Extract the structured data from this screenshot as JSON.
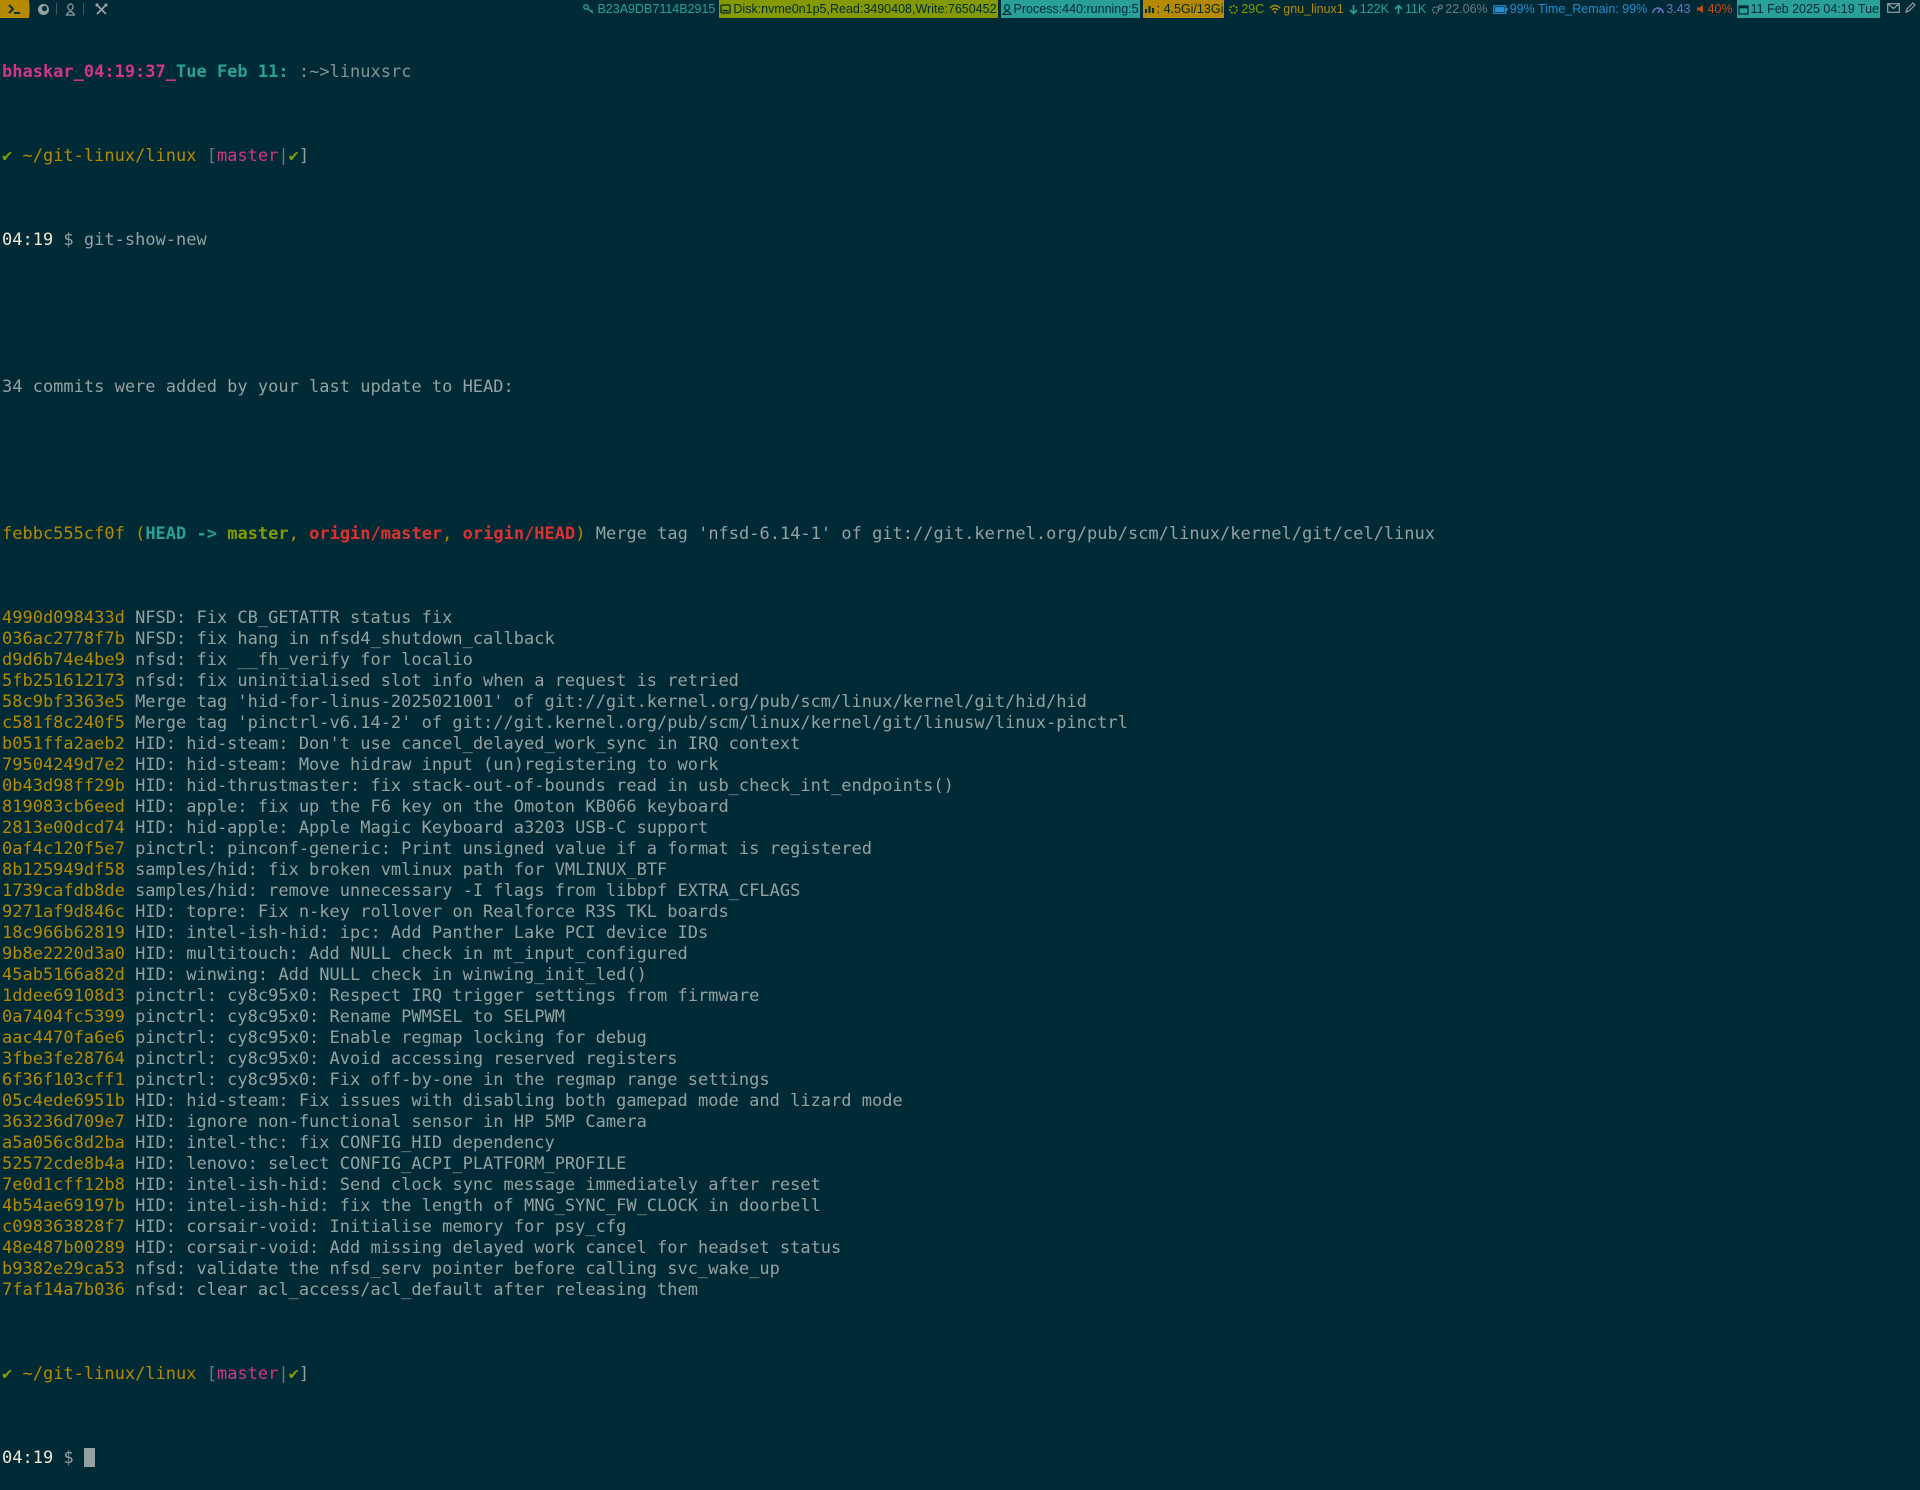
{
  "colors": {
    "background": "#002b36",
    "foreground": "#93a1a1",
    "yellow": "#b58900",
    "magenta": "#d33682",
    "cyan": "#2aa198",
    "green": "#859900",
    "red": "#dc322f",
    "blue": "#268bd2",
    "violet": "#6c71c4",
    "orange": "#cb4b16"
  },
  "statusbar": {
    "workspaces": [
      {
        "icon": "terminal-icon",
        "active": true
      },
      {
        "icon": "firefox-icon",
        "active": false
      },
      {
        "icon": "linux-tux-icon",
        "active": false
      },
      {
        "icon": "tools-icon",
        "active": false
      }
    ],
    "key_id": "B23A9DB7114B2915",
    "disk": "Disk:nvme0n1p5,Read:3490408,Write:7650452",
    "process": "Process:440:running:5",
    "memory": ": 4.5Gi/13Gi",
    "temperature": "29C",
    "network_name": "gnu_linux1",
    "download": "122K",
    "upload": "11K",
    "cpu": "22.06%",
    "battery": "99% Time_Remain: 99%",
    "load": "3.43",
    "volume": "40%",
    "datetime": "11 Feb 2025 04:19 Tue"
  },
  "terminal": {
    "title_user": "bhaskar_04:19:37_",
    "title_day": "Tue Feb 11",
    "title_colon": ":",
    "title_path": " :~>linuxsrc",
    "prompt_check": "✔",
    "prompt_path": " ~/git-linux/linux",
    "prompt_bracket_open": " [",
    "prompt_branch": "master",
    "prompt_pipe": "|",
    "prompt_bracket_close": "]",
    "prompt_time": "04:19",
    "prompt_dollar": " $ ",
    "command": "git-show-new",
    "summary": "34 commits were added by your last update to HEAD:",
    "merge_head": {
      "hash": "febbc555cf0f",
      "paren_open": " (",
      "head": "HEAD -> ",
      "branch": "master",
      "sep1": ", ",
      "remote1": "origin/master",
      "sep2": ", ",
      "remote2": "origin/HEAD",
      "paren_close": ")",
      "message": " Merge tag 'nfsd-6.14-1' of git://git.kernel.org/pub/scm/linux/kernel/git/cel/linux"
    },
    "commits": [
      {
        "hash": "4990d098433d",
        "message": " NFSD: Fix CB_GETATTR status fix"
      },
      {
        "hash": "036ac2778f7b",
        "message": " NFSD: fix hang in nfsd4_shutdown_callback"
      },
      {
        "hash": "d9d6b74e4be9",
        "message": " nfsd: fix __fh_verify for localio"
      },
      {
        "hash": "5fb251612173",
        "message": " nfsd: fix uninitialised slot info when a request is retried"
      },
      {
        "hash": "58c9bf3363e5",
        "message": " Merge tag 'hid-for-linus-2025021001' of git://git.kernel.org/pub/scm/linux/kernel/git/hid/hid"
      },
      {
        "hash": "c581f8c240f5",
        "message": " Merge tag 'pinctrl-v6.14-2' of git://git.kernel.org/pub/scm/linux/kernel/git/linusw/linux-pinctrl"
      },
      {
        "hash": "b051ffa2aeb2",
        "message": " HID: hid-steam: Don't use cancel_delayed_work_sync in IRQ context"
      },
      {
        "hash": "79504249d7e2",
        "message": " HID: hid-steam: Move hidraw input (un)registering to work"
      },
      {
        "hash": "0b43d98ff29b",
        "message": " HID: hid-thrustmaster: fix stack-out-of-bounds read in usb_check_int_endpoints()"
      },
      {
        "hash": "819083cb6eed",
        "message": " HID: apple: fix up the F6 key on the Omoton KB066 keyboard"
      },
      {
        "hash": "2813e00dcd74",
        "message": " HID: hid-apple: Apple Magic Keyboard a3203 USB-C support"
      },
      {
        "hash": "0af4c120f5e7",
        "message": " pinctrl: pinconf-generic: Print unsigned value if a format is registered"
      },
      {
        "hash": "8b125949df58",
        "message": " samples/hid: fix broken vmlinux path for VMLINUX_BTF"
      },
      {
        "hash": "1739cafdb8de",
        "message": " samples/hid: remove unnecessary -I flags from libbpf EXTRA_CFLAGS"
      },
      {
        "hash": "9271af9d846c",
        "message": " HID: topre: Fix n-key rollover on Realforce R3S TKL boards"
      },
      {
        "hash": "18c966b62819",
        "message": " HID: intel-ish-hid: ipc: Add Panther Lake PCI device IDs"
      },
      {
        "hash": "9b8e2220d3a0",
        "message": " HID: multitouch: Add NULL check in mt_input_configured"
      },
      {
        "hash": "45ab5166a82d",
        "message": " HID: winwing: Add NULL check in winwing_init_led()"
      },
      {
        "hash": "1ddee69108d3",
        "message": " pinctrl: cy8c95x0: Respect IRQ trigger settings from firmware"
      },
      {
        "hash": "0a7404fc5399",
        "message": " pinctrl: cy8c95x0: Rename PWMSEL to SELPWM"
      },
      {
        "hash": "aac4470fa6e6",
        "message": " pinctrl: cy8c95x0: Enable regmap locking for debug"
      },
      {
        "hash": "3fbe3fe28764",
        "message": " pinctrl: cy8c95x0: Avoid accessing reserved registers"
      },
      {
        "hash": "6f36f103cff1",
        "message": " pinctrl: cy8c95x0: Fix off-by-one in the regmap range settings"
      },
      {
        "hash": "05c4ede6951b",
        "message": " HID: hid-steam: Fix issues with disabling both gamepad mode and lizard mode"
      },
      {
        "hash": "363236d709e7",
        "message": " HID: ignore non-functional sensor in HP 5MP Camera"
      },
      {
        "hash": "a5a056c8d2ba",
        "message": " HID: intel-thc: fix CONFIG_HID dependency"
      },
      {
        "hash": "52572cde8b4a",
        "message": " HID: lenovo: select CONFIG_ACPI_PLATFORM_PROFILE"
      },
      {
        "hash": "7e0d1cff12b8",
        "message": " HID: intel-ish-hid: Send clock sync message immediately after reset"
      },
      {
        "hash": "4b54ae69197b",
        "message": " HID: intel-ish-hid: fix the length of MNG_SYNC_FW_CLOCK in doorbell"
      },
      {
        "hash": "c098363828f7",
        "message": " HID: corsair-void: Initialise memory for psy_cfg"
      },
      {
        "hash": "48e487b00289",
        "message": " HID: corsair-void: Add missing delayed work cancel for headset status"
      },
      {
        "hash": "b9382e29ca53",
        "message": " nfsd: validate the nfsd_serv pointer before calling svc_wake_up"
      },
      {
        "hash": "7faf14a7b036",
        "message": " nfsd: clear acl_access/acl_default after releasing them"
      }
    ]
  }
}
